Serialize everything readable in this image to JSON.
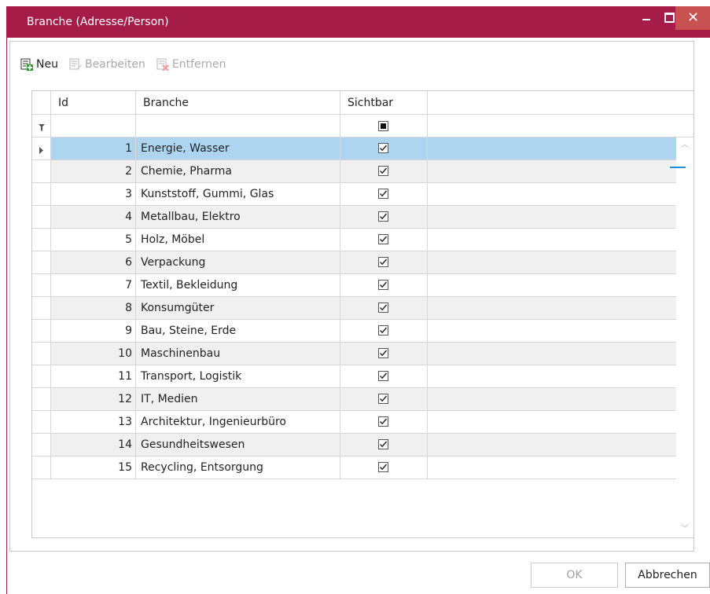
{
  "window": {
    "title": "Branche (Adresse/Person)",
    "accent_color": "#a51c48",
    "close_color": "#c75050"
  },
  "toolbar": {
    "new_label": "Neu",
    "edit_label": "Bearbeiten",
    "remove_label": "Entfernen",
    "new_icon": "add-document-icon",
    "edit_icon": "edit-document-icon",
    "remove_icon": "delete-document-icon"
  },
  "grid": {
    "columns": [
      "Id",
      "Branche",
      "Sichtbar"
    ],
    "filter_icon": "filter-icon",
    "selected_row": 0,
    "rows": [
      {
        "id": "1",
        "name": "Energie, Wasser",
        "visible": true
      },
      {
        "id": "2",
        "name": "Chemie, Pharma",
        "visible": true
      },
      {
        "id": "3",
        "name": "Kunststoff, Gummi, Glas",
        "visible": true
      },
      {
        "id": "4",
        "name": "Metallbau, Elektro",
        "visible": true
      },
      {
        "id": "5",
        "name": "Holz, Möbel",
        "visible": true
      },
      {
        "id": "6",
        "name": "Verpackung",
        "visible": true
      },
      {
        "id": "7",
        "name": "Textil, Bekleidung",
        "visible": true
      },
      {
        "id": "8",
        "name": "Konsumgüter",
        "visible": true
      },
      {
        "id": "9",
        "name": "Bau, Steine, Erde",
        "visible": true
      },
      {
        "id": "10",
        "name": "Maschinenbau",
        "visible": true
      },
      {
        "id": "11",
        "name": "Transport, Logistik",
        "visible": true
      },
      {
        "id": "12",
        "name": "IT, Medien",
        "visible": true
      },
      {
        "id": "13",
        "name": "Architektur, Ingenieurbüro",
        "visible": true
      },
      {
        "id": "14",
        "name": "Gesundheitswesen",
        "visible": true
      },
      {
        "id": "15",
        "name": "Recycling, Entsorgung",
        "visible": true
      }
    ]
  },
  "footer": {
    "ok_label": "OK",
    "cancel_label": "Abbrechen"
  }
}
